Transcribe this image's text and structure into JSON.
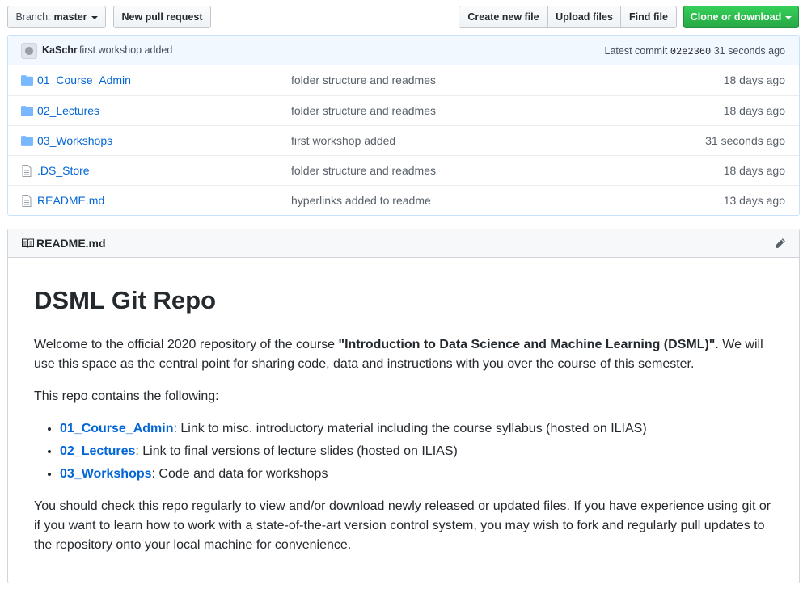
{
  "toolbar": {
    "branch_prefix": "Branch:",
    "branch_name": "master",
    "new_pull_request": "New pull request",
    "create_new_file": "Create new file",
    "upload_files": "Upload files",
    "find_file": "Find file",
    "clone_or_download": "Clone or download"
  },
  "commit": {
    "author": "KaSchr",
    "message": "first workshop added",
    "latest_commit_label": "Latest commit",
    "sha": "02e2360",
    "age": "31 seconds ago"
  },
  "files": [
    {
      "name": "01_Course_Admin",
      "type": "folder",
      "message": "folder structure and readmes",
      "age": "18 days ago"
    },
    {
      "name": "02_Lectures",
      "type": "folder",
      "message": "folder structure and readmes",
      "age": "18 days ago"
    },
    {
      "name": "03_Workshops",
      "type": "folder",
      "message": "first workshop added",
      "age": "31 seconds ago"
    },
    {
      "name": ".DS_Store",
      "type": "file",
      "message": "folder structure and readmes",
      "age": "18 days ago"
    },
    {
      "name": "README.md",
      "type": "file",
      "message": "hyperlinks added to readme",
      "age": "13 days ago"
    }
  ],
  "readme": {
    "header_title": "README.md",
    "h1": "DSML Git Repo",
    "intro_before": "Welcome to the official 2020 repository of the course ",
    "intro_bold": "\"Introduction to Data Science and Machine Learning (DSML)\"",
    "intro_after": ". We will use this space as the central point for sharing code, data and instructions with you over the course of this semester.",
    "contains": "This repo contains the following:",
    "items": [
      {
        "link": "01_Course_Admin",
        "text": ": Link to misc. introductory material including the course syllabus (hosted on ILIAS)"
      },
      {
        "link": "02_Lectures",
        "text": ": Link to final versions of lecture slides (hosted on ILIAS)"
      },
      {
        "link": "03_Workshops",
        "text": ": Code and data for workshops"
      }
    ],
    "closing": "You should check this repo regularly to view and/or download newly released or updated files. If you have experience using git or if you want to learn how to work with a state-of-the-art version control system, you may wish to fork and regularly pull updates to the repository onto your local machine for convenience."
  },
  "colors": {
    "link": "#0366d6",
    "green_button": "#28a745",
    "commit_bar_bg": "#f1f8ff",
    "folder_icon": "#79b8ff"
  }
}
